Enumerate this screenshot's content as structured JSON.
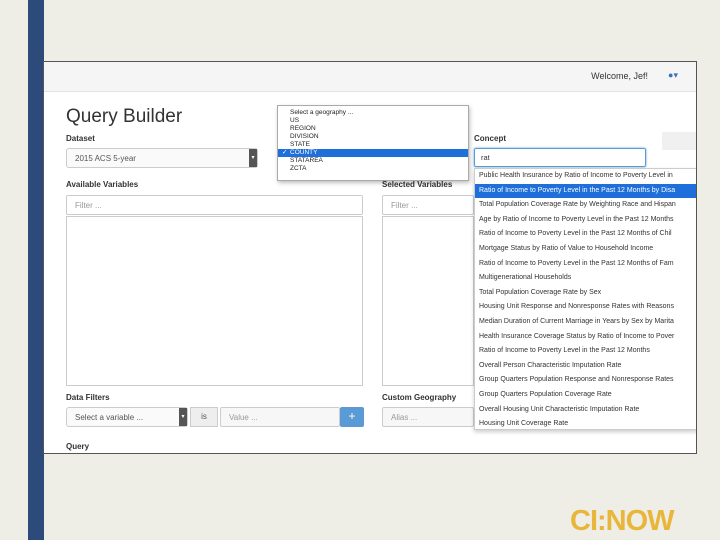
{
  "header": {
    "welcome": "Welcome, Jef!",
    "user_icon": "user-icon"
  },
  "page": {
    "title": "Query Builder"
  },
  "dataset": {
    "label": "Dataset",
    "value": "2015 ACS 5-year"
  },
  "geography_dropdown": {
    "options": [
      "Select a geography ...",
      "US",
      "REGION",
      "DIVISION",
      "STATE",
      "COUNTY",
      "STATAREA",
      "ZCTA"
    ],
    "selected": "COUNTY",
    "check_mark": "✓"
  },
  "concept": {
    "label": "Concept",
    "value": "rat",
    "suggestions": [
      "Public Health Insurance by Ratio of Income to Poverty Level in",
      "Ratio of Income to Poverty Level in the Past 12 Months by Disa",
      "Total Population Coverage Rate by Weighting Race and Hispan",
      "Age by Ratio of Income to Poverty Level in the Past 12 Months",
      "Ratio of Income to Poverty Level in the Past 12 Months of Chil",
      "Mortgage Status by Ratio of Value to Household Income",
      "Ratio of Income to Poverty Level in the Past 12 Months of Fam",
      "Multigenerational Households",
      "Total Population Coverage Rate by Sex",
      "Housing Unit Response and Nonresponse Rates with Reasons",
      "Median Duration of Current Marriage in Years by Sex by Marita",
      "Health Insurance Coverage Status by Ratio of Income to Pover",
      "Ratio of Income to Poverty Level in the Past 12 Months",
      "Overall Person Characteristic Imputation Rate",
      "Group Quarters Population Response and Nonresponse Rates",
      "Group Quarters Population Coverage Rate",
      "Overall Housing Unit Characteristic Imputation Rate",
      "Housing Unit Coverage Rate"
    ],
    "highlighted_index": 1
  },
  "available_variables": {
    "label": "Available Variables",
    "placeholder": "Filter ..."
  },
  "selected_variables": {
    "label": "Selected Variables",
    "placeholder": "Filter ..."
  },
  "data_filters": {
    "label": "Data Filters",
    "variable_placeholder": "Select a variable ...",
    "operator": "is",
    "value_placeholder": "Value ...",
    "add_label": "+"
  },
  "custom_geography": {
    "label": "Custom Geography",
    "placeholder": "Alias ..."
  },
  "query": {
    "label": "Query"
  },
  "logo": {
    "text": "CI:NOW"
  },
  "colors": {
    "accent": "#1e6fd9",
    "sidebar": "#2c4a7a",
    "logo": "#e8b63a",
    "button": "#5b9bd5"
  }
}
